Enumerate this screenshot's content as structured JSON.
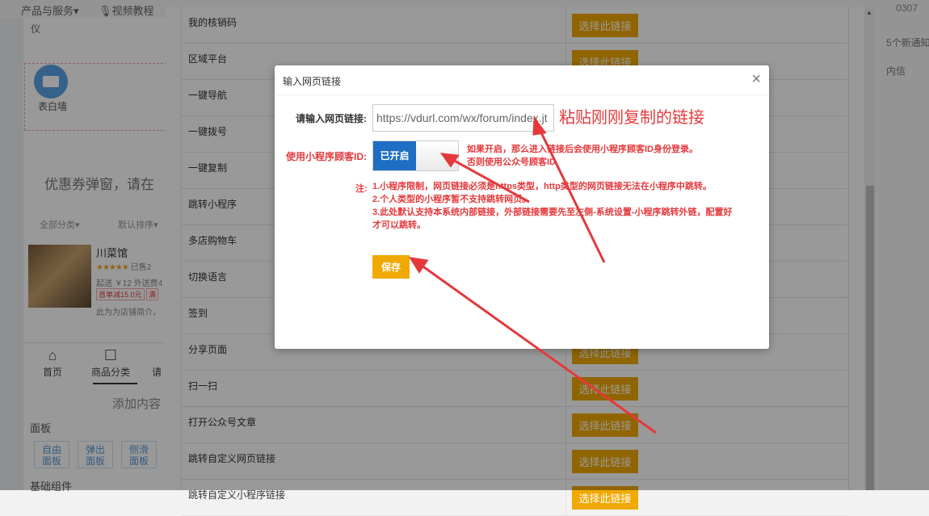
{
  "topbar": {
    "products": "产品与服务",
    "products_caret": "▾",
    "video": "视频教程",
    "user_id": "0307"
  },
  "left_panel": {
    "partial_top": "仪",
    "wall_label": "表白墙",
    "coupon_text": "优惠券弹窗，请在",
    "filters": [
      "全部分类",
      "默认排序"
    ],
    "filters_caret": "▾",
    "shop": {
      "name": "川菜馆",
      "rating_stars": "★★★★★",
      "sold": "已售2",
      "price_line": "起送 ￥12  外送费4",
      "tags": [
        "首单减15.0元",
        "满"
      ],
      "desc": "此为为店铺简介，"
    },
    "bottom_nav": [
      {
        "icon": "⌂",
        "label": "首页"
      },
      {
        "icon": "☐",
        "label": "商品分类"
      },
      {
        "icon": "",
        "label": "请"
      }
    ],
    "add_content": "添加内容",
    "panel_title": "面板",
    "panel_buttons": [
      {
        "line1": "自由",
        "line2": "面板"
      },
      {
        "line1": "弹出",
        "line2": "面板"
      },
      {
        "line1": "侧滑",
        "line2": "面板"
      }
    ],
    "basic_title": "基础组件"
  },
  "right_panel": {
    "notice": "5个新通知",
    "mail": "内信"
  },
  "link_list": {
    "pick_label": "选择此链接",
    "rows": [
      {
        "name": "我的核销码"
      },
      {
        "name": "区域平台"
      },
      {
        "name": "一键导航"
      },
      {
        "name": "一键拨号"
      },
      {
        "name": "一键复制"
      },
      {
        "name": "跳转小程序"
      },
      {
        "name": "多店购物车"
      },
      {
        "name": "切换语言"
      },
      {
        "name": "签到"
      },
      {
        "name": "分享页面"
      },
      {
        "name": "扫一扫"
      },
      {
        "name": "打开公众号文章"
      },
      {
        "name": "跳转自定义网页链接"
      },
      {
        "name": "跳转自定义小程序链接"
      }
    ]
  },
  "dialog": {
    "title": "输入网页链接",
    "close": "×",
    "url_label": "请输入网页链接:",
    "url_value": "https://vdurl.com/wx/forum/index.jt",
    "paste_hint": "粘贴刚刚复制的链接",
    "mini_label": "使用小程序顾客ID:",
    "toggle_on": "已开启",
    "mini_desc_line1": "如果开启，那么进入链接后会使用小程序顾客ID身份登录。",
    "mini_desc_line2": "否则使用公众号顾客ID",
    "note_label": "注:",
    "notes": [
      "1.小程序限制，网页链接必须是https类型，http类型的网页链接无法在小程序中跳转。",
      "2.个人类型的小程序暂不支持跳转网页。",
      "3.此处默认支持本系统内部链接，外部链接需要先至左侧-系统设置-小程序跳转外链，配置好才可以跳转。"
    ],
    "save": "保存"
  },
  "colors": {
    "accent_yellow": "#f0a900",
    "toggle_blue": "#1e6ec3",
    "annotation_red": "#e4393c"
  }
}
